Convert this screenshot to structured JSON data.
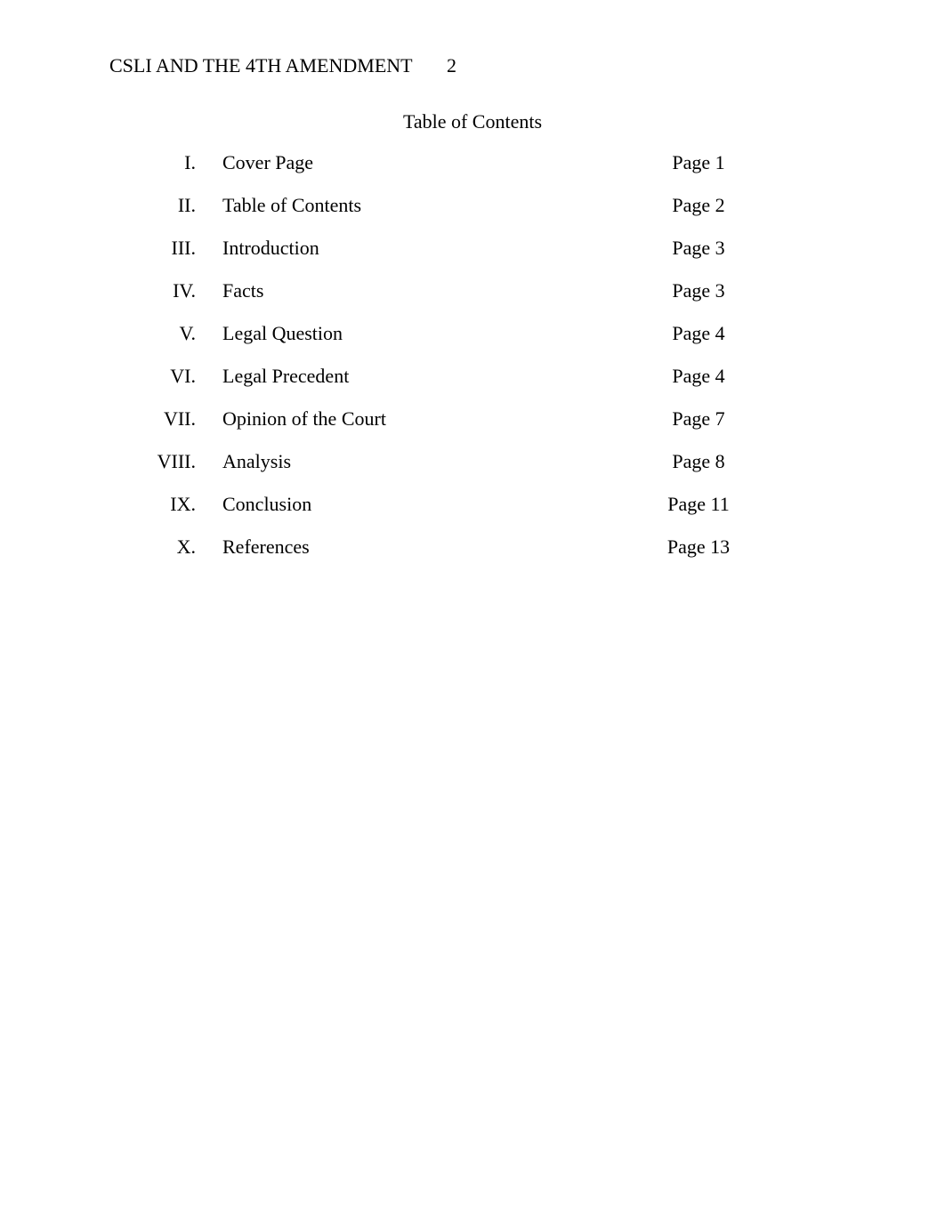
{
  "header": {
    "title": "CSLI AND THE 4TH AMENDMENT",
    "page_number": "2"
  },
  "document": {
    "toc_title": "Table of Contents"
  },
  "toc": {
    "entries": [
      {
        "numeral": "I.",
        "label": "Cover Page",
        "page_ref": "Page 1"
      },
      {
        "numeral": "II.",
        "label": "Table of Contents",
        "page_ref": "Page 2"
      },
      {
        "numeral": "III.",
        "label": "Introduction",
        "page_ref": "Page 3"
      },
      {
        "numeral": "IV.",
        "label": "Facts",
        "page_ref": "Page 3"
      },
      {
        "numeral": "V.",
        "label": "Legal Question",
        "page_ref": "Page 4"
      },
      {
        "numeral": "VI.",
        "label": "Legal Precedent",
        "page_ref": "Page 4"
      },
      {
        "numeral": "VII.",
        "label": "Opinion of the Court",
        "page_ref": "Page 7"
      },
      {
        "numeral": "VIII.",
        "label": "Analysis",
        "page_ref": "Page 8"
      },
      {
        "numeral": "IX.",
        "label": "Conclusion",
        "page_ref": "Page 11"
      },
      {
        "numeral": "X.",
        "label": "References",
        "page_ref": "Page 13"
      }
    ]
  }
}
